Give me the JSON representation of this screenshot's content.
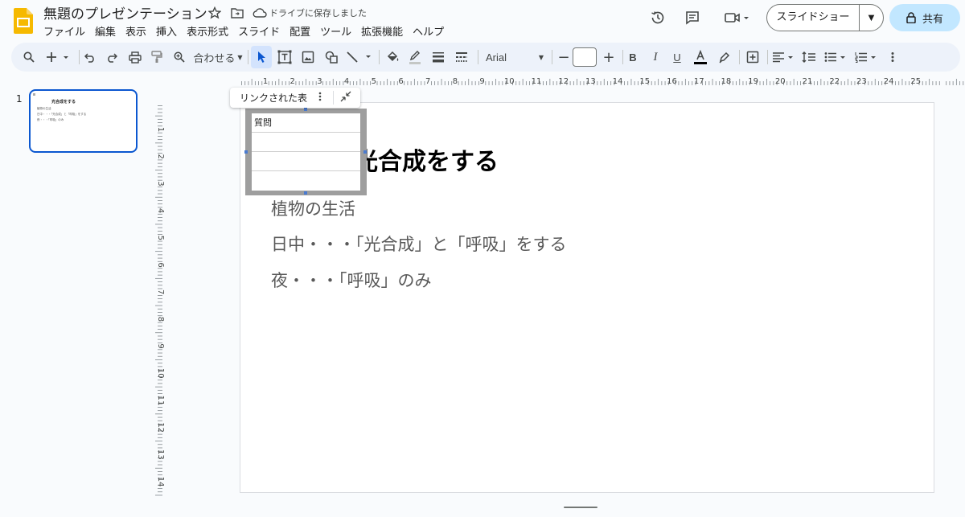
{
  "app": {
    "title": "無題のプレゼンテーション",
    "save_status": "ドライブに保存しました",
    "menu": [
      "ファイル",
      "編集",
      "表示",
      "挿入",
      "表示形式",
      "スライド",
      "配置",
      "ツール",
      "拡張機能",
      "ヘルプ"
    ],
    "slideshow_label": "スライドショー",
    "share_label": "共有",
    "accent_color": "#0b57d0",
    "logo_color": "#f6b900"
  },
  "toolbar": {
    "zoom_label": "合わせる",
    "font_name": "Arial",
    "font_size": "",
    "icons": [
      "search-icon",
      "add-icon",
      "undo-icon",
      "redo-icon",
      "print-icon",
      "paint-format-icon",
      "zoom-icon",
      "select-icon",
      "text-box-icon",
      "image-icon",
      "shape-icon",
      "line-icon",
      "fill-color-icon",
      "border-color-icon",
      "border-weight-icon",
      "border-dash-icon",
      "decrease-font-icon",
      "increase-font-icon",
      "bold-icon",
      "italic-icon",
      "underline-icon",
      "text-color-icon",
      "highlight-icon",
      "insert-link-icon",
      "align-icon",
      "line-spacing-icon",
      "bulleted-list-icon",
      "numbered-list-icon",
      "more-icon"
    ]
  },
  "filmstrip": {
    "slide_number": "1",
    "thumb_title": "光合成をする",
    "thumb_lines": [
      "植物の生活",
      "日中・・・「光合成」と「呼吸」をする",
      "夜・・・「呼吸」のみ"
    ]
  },
  "ruler": {
    "h_labels": [
      "1",
      "2",
      "3",
      "4",
      "5",
      "6",
      "7",
      "8",
      "9",
      "10",
      "11",
      "12",
      "13",
      "14",
      "15",
      "16",
      "17",
      "18",
      "19",
      "20",
      "21",
      "22",
      "23",
      "24",
      "25"
    ],
    "v_labels": [
      "1",
      "2",
      "3",
      "4",
      "5",
      "6",
      "7",
      "8",
      "9",
      "10",
      "11",
      "12",
      "13",
      "14"
    ]
  },
  "slide": {
    "title_visible": "光合成をする",
    "body": [
      "植物の生活",
      "日中・・・「光合成」と「呼吸」をする",
      "夜・・・「呼吸」のみ"
    ],
    "linked_table": {
      "bar_label": "リンクされた表",
      "header": "質問",
      "rows": [
        "",
        "",
        ""
      ]
    }
  }
}
